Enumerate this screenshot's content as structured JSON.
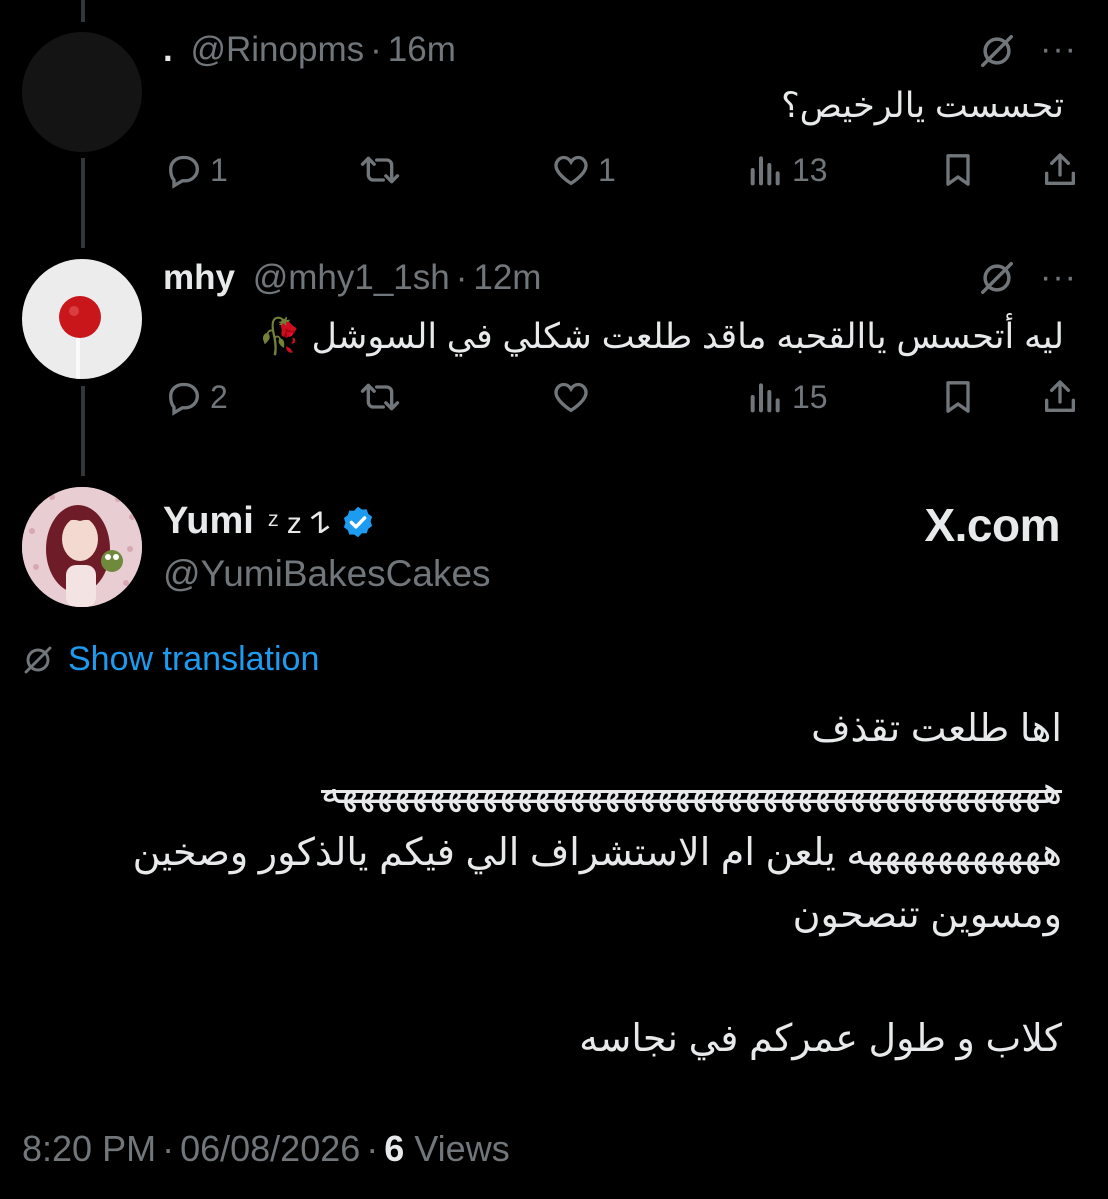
{
  "reply1": {
    "name": ".",
    "handle": "@Rinopms",
    "time": "16m",
    "text": "تحسست يالرخيص؟",
    "replies": "1",
    "reposts": "",
    "likes": "1",
    "views": "13"
  },
  "reply2": {
    "name": "mhy",
    "handle": "@mhy1_1sh",
    "time": "12m",
    "text": "ليه أتحسس ياالقحبه ماقد طلعت شكلي في السوشل 🥀",
    "replies": "2",
    "reposts": "",
    "likes": "",
    "views": "15"
  },
  "main": {
    "name": "Yumi",
    "name_deco": "ᶻ z 𐰁",
    "handle": "@YumiBakesCakes",
    "watermark": "X.com",
    "translate_label": "Show translation",
    "lines": [
      "اها طلعت تقذف",
      "هههههههههههههههههههههههههههههههههههههههههه",
      "هههههههههههه يلعن ام الاستشراف الي فيكم يالذكور وصخين",
      "ومسوين تنصحون",
      "",
      "كلاب و طول عمركم في نجاسه"
    ],
    "time": "8:20 PM",
    "date": "06/08/2026",
    "views_count": "6",
    "views_label": "Views"
  },
  "colors": {
    "background": "#000000",
    "text": "#e7e9ea",
    "muted": "#71767b",
    "accent": "#1d9bf0",
    "thread_line": "#333639"
  },
  "icons": [
    "reply-icon",
    "repost-icon",
    "like-icon",
    "views-icon",
    "bookmark-icon",
    "share-icon",
    "grok-icon",
    "more-icon",
    "verified-badge-icon",
    "translate-icon"
  ]
}
